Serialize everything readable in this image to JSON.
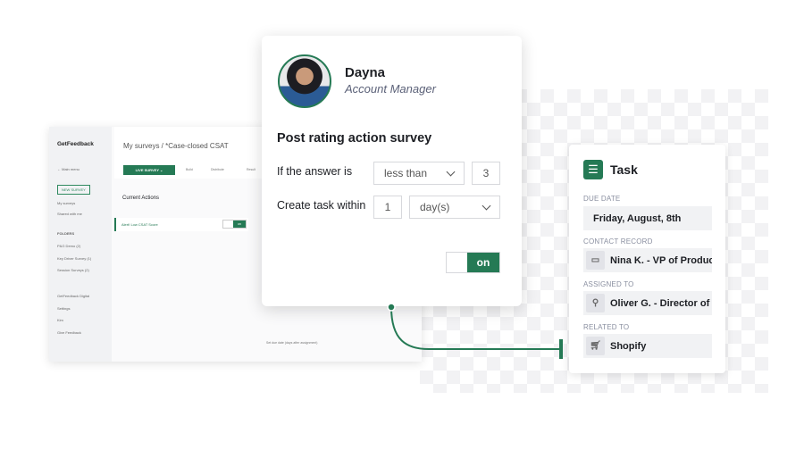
{
  "app": {
    "logo": "GetFeedback",
    "breadcrumb": "My surveys / *Case-closed CSAT",
    "live_survey_button": "LIVE SURVEY ⌄",
    "nav": [
      "Build",
      "Distribute",
      "Result"
    ],
    "sidebar": {
      "main_menu": "← Main menu",
      "new_survey": "NEW SURVEY",
      "items": [
        "My surveys",
        "Shared with me"
      ],
      "folders_heading": "FOLDERS",
      "folders": [
        "P&G Demo (2)",
        "Key Driver Survey (1)",
        "Session Surveys (2)"
      ],
      "bottom": [
        "GetFeedback Digital",
        "Settings",
        "Kim",
        "Give Feedback"
      ]
    },
    "current_actions": "Current Actions",
    "action_item": "Alert! Low CSAT Score",
    "action_toggle": "on",
    "footer_hint": "Set due date (days after assignment)"
  },
  "popup": {
    "name": "Dayna",
    "role": "Account Manager",
    "title": "Post rating action survey",
    "row1_label": "If the answer is",
    "row1_select": "less than",
    "row1_value": "3",
    "row2_label": "Create task within",
    "row2_value": "1",
    "row2_select": "day(s)",
    "toggle": "on"
  },
  "task": {
    "title": "Task",
    "due_label": "DUE DATE",
    "due_value": "Friday, August, 8th",
    "contact_label": "CONTACT RECORD",
    "contact_value": "Nina K. - VP of Product",
    "assigned_label": "ASSIGNED TO",
    "assigned_value": "Oliver G. - Director of S",
    "related_label": "RELATED TO",
    "related_value": "Shopify"
  },
  "colors": {
    "accent": "#257a55"
  }
}
